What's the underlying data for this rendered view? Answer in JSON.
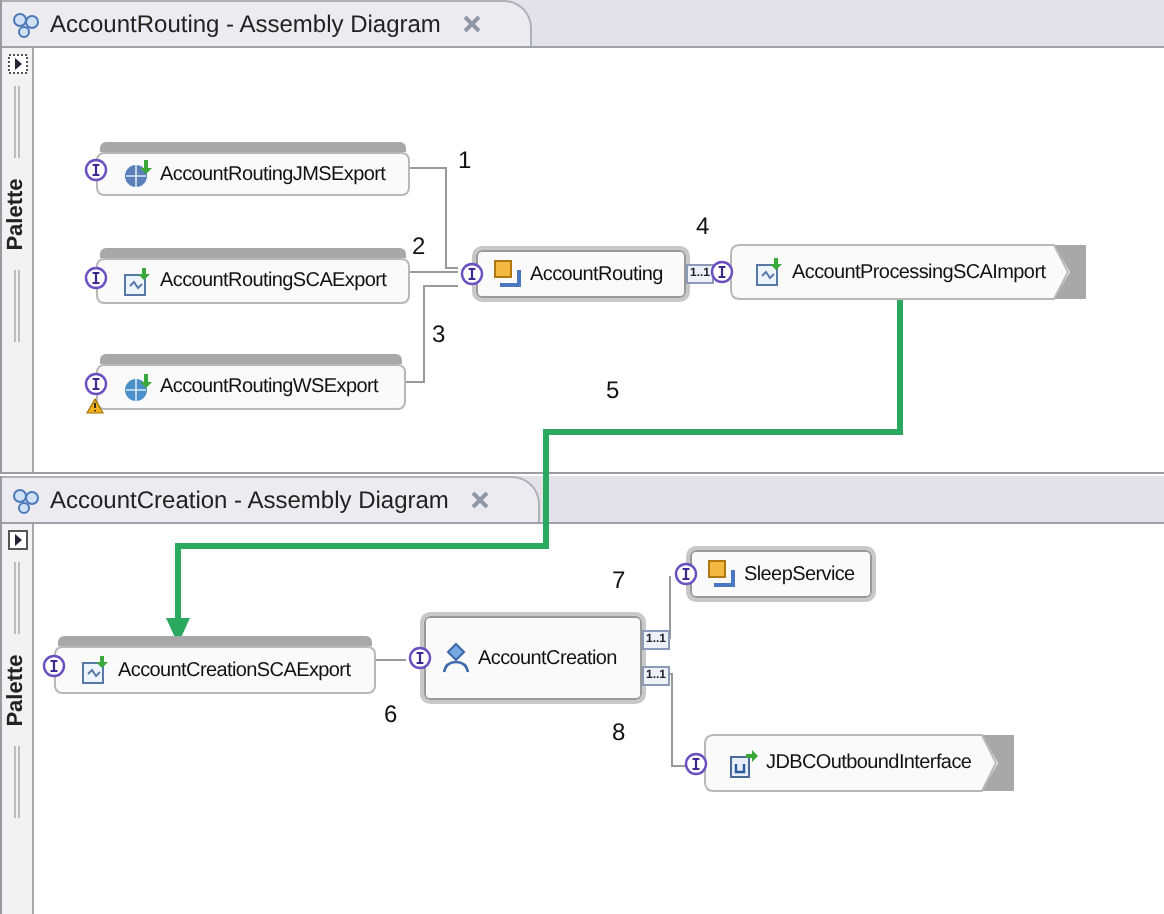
{
  "editors": [
    {
      "title": "AccountRouting - Assembly Diagram",
      "palette": "Palette",
      "nodes": [
        {
          "kind": "export",
          "label": "AccountRoutingJMSExport",
          "warning": false
        },
        {
          "kind": "export",
          "label": "AccountRoutingSCAExport",
          "warning": false
        },
        {
          "kind": "export",
          "label": "AccountRoutingWSExport",
          "warning": true
        },
        {
          "kind": "component",
          "label": "AccountRouting",
          "references": [
            "1..1"
          ]
        },
        {
          "kind": "import",
          "label": "AccountProcessingSCAImport"
        }
      ],
      "wire_labels": [
        "1",
        "2",
        "3",
        "4",
        "5"
      ]
    },
    {
      "title": "AccountCreation - Assembly Diagram",
      "palette": "Palette",
      "nodes": [
        {
          "kind": "export",
          "label": "AccountCreationSCAExport",
          "warning": false
        },
        {
          "kind": "component",
          "label": "AccountCreation",
          "references": [
            "1..1",
            "1..1"
          ]
        },
        {
          "kind": "component",
          "label": "SleepService"
        },
        {
          "kind": "import",
          "label": "JDBCOutboundInterface"
        }
      ],
      "wire_labels": [
        "6",
        "7",
        "8"
      ]
    }
  ]
}
